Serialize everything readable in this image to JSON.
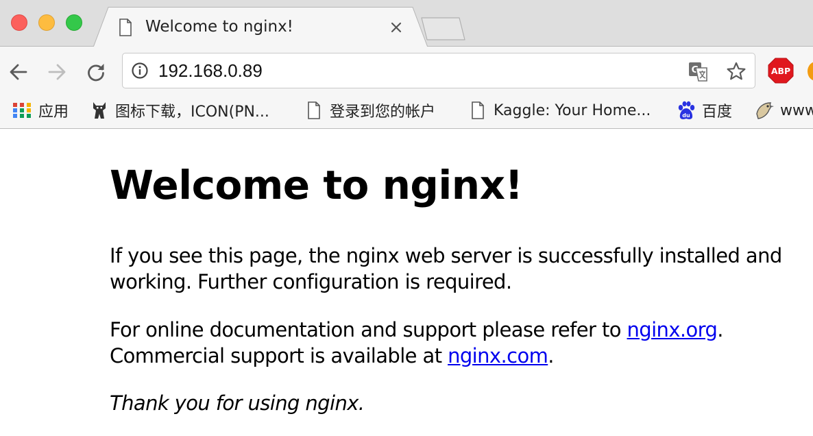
{
  "window": {
    "controls": [
      "close",
      "minimize",
      "maximize"
    ]
  },
  "tab": {
    "title": "Welcome to nginx!",
    "favicon": "page-icon"
  },
  "toolbar": {
    "url": "192.168.0.89",
    "icons": [
      "back-icon",
      "forward-icon",
      "reload-icon",
      "info-icon",
      "translate-icon",
      "star-icon"
    ],
    "extension_label": "ABP"
  },
  "bookmarks": [
    {
      "label": "应用",
      "icon": "apps-grid-icon"
    },
    {
      "label": "图标下载，ICON(PN...",
      "icon": "icon-site-icon"
    },
    {
      "label": "登录到您的帐户",
      "icon": "page-icon"
    },
    {
      "label": "Kaggle: Your Home...",
      "icon": "page-icon"
    },
    {
      "label": "百度",
      "icon": "baidu-paw-icon"
    },
    {
      "label": "www",
      "icon": "bird-icon"
    }
  ],
  "page": {
    "title": "Welcome to nginx!",
    "intro": "If you see this page, the nginx web server is successfully installed and",
    "intro_2": "working. Further configuration is required.",
    "docs_prefix": "For online documentation and support please refer to ",
    "docs_link": "nginx.org",
    "docs_suffix": ".",
    "commercial_prefix": "Commercial support is available at ",
    "commercial_link": "nginx.com",
    "commercial_suffix": ".",
    "thanks": "Thank you for using nginx."
  },
  "colors": {
    "link": "#0000ee",
    "traffic_close": "#fc605c",
    "traffic_min": "#fdbc40",
    "traffic_max": "#34c84a",
    "abp_red": "#e0181e"
  }
}
